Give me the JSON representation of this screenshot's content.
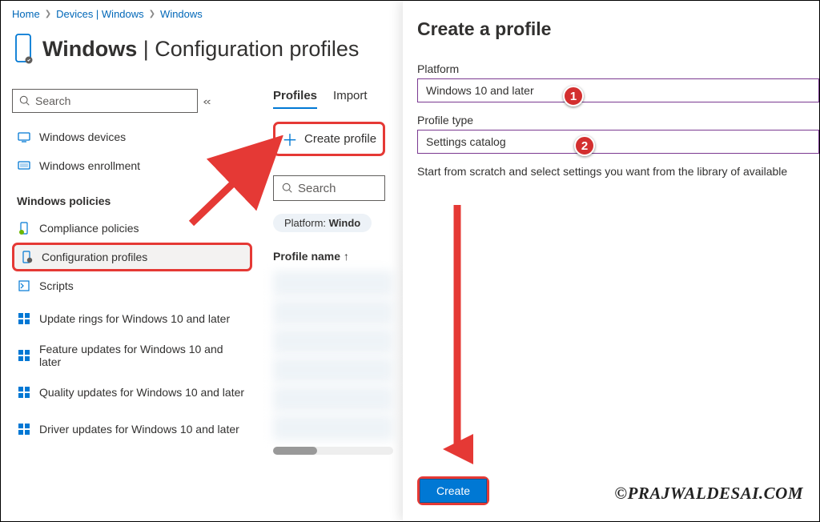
{
  "breadcrumb": {
    "items": [
      "Home",
      "Devices | Windows",
      "Windows"
    ]
  },
  "header": {
    "strong": "Windows",
    "suffix": " | Configuration profiles"
  },
  "sidebar": {
    "search_placeholder": "Search",
    "items_top": [
      {
        "label": "Windows devices"
      },
      {
        "label": "Windows enrollment"
      }
    ],
    "section_label": "Windows policies",
    "items_policies": [
      {
        "label": "Compliance policies"
      },
      {
        "label": "Configuration profiles"
      },
      {
        "label": "Scripts"
      },
      {
        "label": "Update rings for Windows 10 and later"
      },
      {
        "label": "Feature updates for Windows 10 and later"
      },
      {
        "label": "Quality updates for Windows 10 and later"
      },
      {
        "label": "Driver updates for Windows 10 and later"
      }
    ]
  },
  "mid": {
    "tabs": [
      "Profiles",
      "Import"
    ],
    "create_label": "Create profile",
    "search_placeholder": "Search",
    "filter_prefix": "Platform: ",
    "filter_value": "Windo",
    "col_head": "Profile name ↑"
  },
  "panel": {
    "title": "Create a profile",
    "platform_label": "Platform",
    "platform_value": "Windows 10 and later",
    "type_label": "Profile type",
    "type_value": "Settings catalog",
    "help": "Start from scratch and select settings you want from the library of available",
    "create_button": "Create"
  },
  "badges": {
    "b1": "1",
    "b2": "2"
  },
  "watermark": "©PRAJWALDESAI.COM"
}
